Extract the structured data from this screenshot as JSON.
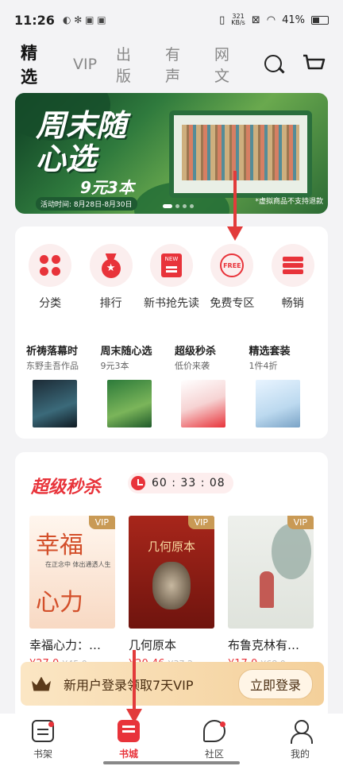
{
  "status": {
    "time": "11:26",
    "speed_top": "321",
    "speed_unit": "KB/s",
    "battery": "41%"
  },
  "topnav": {
    "tabs": [
      "精选",
      "VIP",
      "出版",
      "有声",
      "网文"
    ]
  },
  "banner": {
    "headline": "周末随心选",
    "price": "9元3本",
    "period": "活动时间: 8月28日-8月30日",
    "note": "*虚拟商品不支持退款"
  },
  "categories": [
    "分类",
    "排行",
    "新书抢先读",
    "免费专区",
    "畅销"
  ],
  "free_icon_text": "FREE",
  "new_icon_text": "NEW",
  "promos": [
    {
      "title": "祈祷落幕时",
      "sub": "东野圭吾作品"
    },
    {
      "title": "周末随心选",
      "sub": "9元3本"
    },
    {
      "title": "超级秒杀",
      "sub": "低价来袭"
    },
    {
      "title": "精选套装",
      "sub": "1件4折"
    }
  ],
  "flash": {
    "title": "超级秒杀",
    "timer": "60 : 33 : 08"
  },
  "books": [
    {
      "title": "幸福心力：…",
      "price": "¥27.0",
      "old": "¥45.0",
      "vip": "VIP",
      "cover_a": "幸福",
      "cover_b": "心力",
      "cover_sub": "在正念中 体出通透人生"
    },
    {
      "title": "几何原本",
      "price": "¥20.46",
      "old": "¥37.2",
      "vip": "VIP",
      "cover_title": "几何原本"
    },
    {
      "title": "布鲁克林有…",
      "price": "¥17.0",
      "old": "¥68.0",
      "vip": "VIP"
    }
  ],
  "login": {
    "text": "新用户登录领取7天VIP",
    "button": "立即登录"
  },
  "bottom": [
    "书架",
    "书城",
    "社区",
    "我的"
  ],
  "colors": {
    "accent": "#e8333a",
    "gold": "#c99a55"
  }
}
